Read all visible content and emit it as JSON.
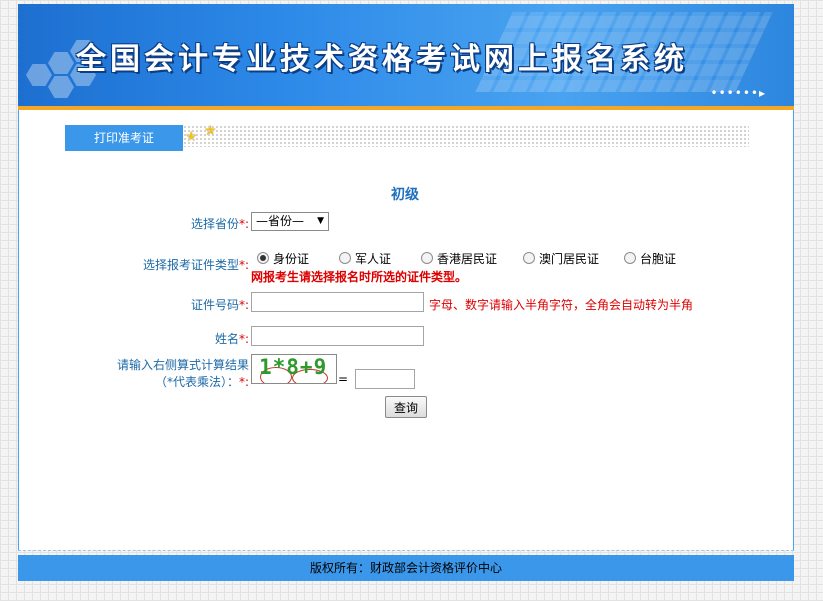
{
  "banner": {
    "title": "全国会计专业技术资格考试网上报名系统"
  },
  "tab": {
    "label": "打印准考证"
  },
  "form": {
    "level_title": "初级",
    "province": {
      "label": "选择省份",
      "required_mark": "*:",
      "selected": "—省份—"
    },
    "id_type": {
      "label": "选择报考证件类型",
      "required_mark": "*:",
      "options": [
        {
          "label": "身份证",
          "checked": true
        },
        {
          "label": "军人证",
          "checked": false
        },
        {
          "label": "香港居民证",
          "checked": false
        },
        {
          "label": "澳门居民证",
          "checked": false
        },
        {
          "label": "台胞证",
          "checked": false
        }
      ],
      "warning": "网报考生请选择报名时所选的证件类型。"
    },
    "id_number": {
      "label": "证件号码",
      "required_mark": "*:",
      "value": "",
      "hint": "字母、数字请输入半角字符，全角会自动转为半角"
    },
    "name": {
      "label": "姓名",
      "required_mark": "*:",
      "value": ""
    },
    "captcha": {
      "label_line1": "请输入右侧算式计算结果",
      "label_line2": "（*代表乘法）：",
      "required_mark": "*:",
      "image_text": "1*8+9",
      "equals": "=",
      "value": ""
    },
    "submit_label": "查询"
  },
  "footer": {
    "text": "版权所有：财政部会计资格评价中心"
  },
  "colors": {
    "brand_blue": "#3b97ea",
    "accent_orange": "#f5a623",
    "required_red": "#dd0000"
  }
}
